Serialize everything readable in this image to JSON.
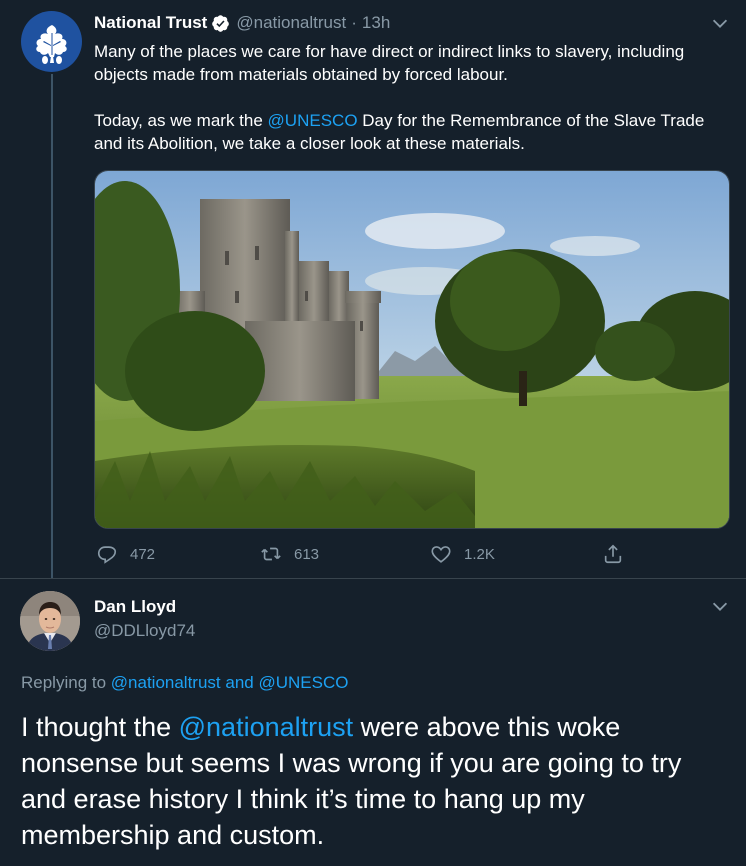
{
  "tweet": {
    "author": {
      "display_name": "National Trust",
      "handle": "@nationaltrust",
      "verified": true
    },
    "separator": "·",
    "time": "13h",
    "text": {
      "paragraph1": "Many of the places we care for have direct or indirect links to slavery, including objects made from materials obtained by forced labour.",
      "p2_prefix": "Today, as we mark the ",
      "p2_mention": "@UNESCO",
      "p2_suffix": " Day for the Remembrance of the Slave Trade and its Abolition, we take a closer look at these materials."
    },
    "actions": {
      "replies": "472",
      "retweets": "613",
      "likes": "1.2K"
    }
  },
  "reply": {
    "author": {
      "display_name": "Dan Lloyd",
      "handle": "@DDLloyd74"
    },
    "replying_to": {
      "prefix": "Replying to ",
      "mention1": "@nationaltrust",
      "joiner": " and ",
      "mention2": "@UNESCO"
    },
    "text": {
      "prefix": "I thought the ",
      "mention": "@nationaltrust",
      "suffix": " were above this woke nonsense but seems I was wrong if you are going to try and erase history I think it’s time to hang up my membership and custom."
    }
  },
  "colors": {
    "background": "#15202b",
    "accent": "#1da1f2",
    "secondary_text": "#8899a6",
    "divider": "#38444d",
    "nt_brand_blue": "#1f52a0"
  },
  "icons": [
    "oak-leaf-logo-icon",
    "verified-badge-icon",
    "chevron-down-icon",
    "reply-icon",
    "retweet-icon",
    "like-icon",
    "share-icon"
  ]
}
